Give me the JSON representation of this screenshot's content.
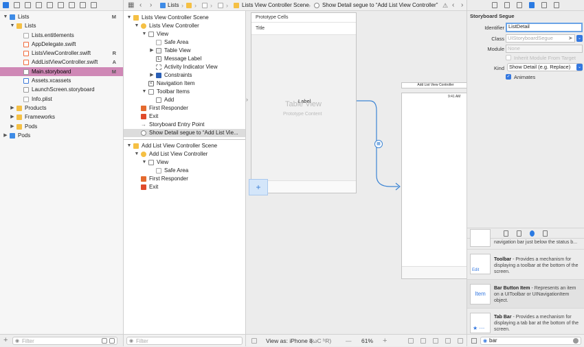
{
  "navigator": {
    "tree": [
      {
        "label": "Lists",
        "badge": "M",
        "level": 0,
        "disclosure": "open",
        "icon": "project-icon",
        "selected": false
      },
      {
        "label": "Lists",
        "badge": "",
        "level": 1,
        "disclosure": "open",
        "icon": "folder-icon",
        "selected": false
      },
      {
        "label": "Lists.entitlements",
        "badge": "",
        "level": 2,
        "disclosure": "",
        "icon": "file-icon",
        "selected": false
      },
      {
        "label": "AppDelegate.swift",
        "badge": "",
        "level": 2,
        "disclosure": "",
        "icon": "swift-icon",
        "selected": false
      },
      {
        "label": "ListsViewController.swift",
        "badge": "R",
        "level": 2,
        "disclosure": "",
        "icon": "swift-icon",
        "selected": false
      },
      {
        "label": "AddListViewController.swift",
        "badge": "A",
        "level": 2,
        "disclosure": "",
        "icon": "swift-icon",
        "selected": false
      },
      {
        "label": "Main.storyboard",
        "badge": "M",
        "level": 2,
        "disclosure": "",
        "icon": "storyboard-icon",
        "selected": true
      },
      {
        "label": "Assets.xcassets",
        "badge": "",
        "level": 2,
        "disclosure": "",
        "icon": "assets-icon",
        "selected": false
      },
      {
        "label": "LaunchScreen.storyboard",
        "badge": "",
        "level": 2,
        "disclosure": "",
        "icon": "storyboard-icon",
        "selected": false
      },
      {
        "label": "Info.plist",
        "badge": "",
        "level": 2,
        "disclosure": "",
        "icon": "plist-icon",
        "selected": false
      },
      {
        "label": "Products",
        "badge": "",
        "level": 1,
        "disclosure": "closed",
        "icon": "folder-icon",
        "selected": false
      },
      {
        "label": "Frameworks",
        "badge": "",
        "level": 1,
        "disclosure": "closed",
        "icon": "folder-icon",
        "selected": false
      },
      {
        "label": "Pods",
        "badge": "",
        "level": 1,
        "disclosure": "closed",
        "icon": "folder-icon",
        "selected": false
      },
      {
        "label": "Pods",
        "badge": "",
        "level": 0,
        "disclosure": "closed",
        "icon": "project-icon",
        "selected": false
      }
    ],
    "filter_placeholder": "Filter"
  },
  "jump_bar": {
    "crumbs": [
      "Lists",
      "",
      "",
      "",
      "Lists View Controller Scene",
      "Show Detail segue to “Add List View Controller”"
    ]
  },
  "outline": {
    "rows": [
      {
        "label": "Lists View Controller Scene",
        "level": 0,
        "disclosure": "open",
        "icon": "scene-icon",
        "selected": false
      },
      {
        "label": "Lists View Controller",
        "level": 1,
        "disclosure": "open",
        "icon": "view-controller-icon",
        "selected": false
      },
      {
        "label": "View",
        "level": 2,
        "disclosure": "open",
        "icon": "view-icon",
        "selected": false
      },
      {
        "label": "Safe Area",
        "level": 3,
        "disclosure": "",
        "icon": "safe-area-icon",
        "selected": false
      },
      {
        "label": "Table View",
        "level": 3,
        "disclosure": "closed",
        "icon": "table-view-icon",
        "selected": false
      },
      {
        "label": "Message Label",
        "level": 3,
        "disclosure": "",
        "icon": "label-icon",
        "selected": false
      },
      {
        "label": "Activity Indicator View",
        "level": 3,
        "disclosure": "",
        "icon": "activity-indicator-icon",
        "selected": false
      },
      {
        "label": "Constraints",
        "level": 3,
        "disclosure": "closed",
        "icon": "constraints-icon",
        "selected": false
      },
      {
        "label": "Navigation Item",
        "level": 2,
        "disclosure": "",
        "icon": "navigation-item-icon",
        "selected": false
      },
      {
        "label": "Toolbar Items",
        "level": 2,
        "disclosure": "open",
        "icon": "toolbar-icon",
        "selected": false
      },
      {
        "label": "Add",
        "level": 3,
        "disclosure": "",
        "icon": "bar-button-item-icon",
        "selected": false
      },
      {
        "label": "First Responder",
        "level": 1,
        "disclosure": "",
        "icon": "first-responder-icon",
        "selected": false
      },
      {
        "label": "Exit",
        "level": 1,
        "disclosure": "",
        "icon": "exit-icon",
        "selected": false
      },
      {
        "label": "Storyboard Entry Point",
        "level": 1,
        "disclosure": "",
        "icon": "entry-point-icon",
        "selected": false
      },
      {
        "label": "Show Detail segue to “Add List Vie...",
        "level": 1,
        "disclosure": "",
        "icon": "segue-icon",
        "selected": true
      }
    ],
    "rows2": [
      {
        "label": "Add List View Controller Scene",
        "level": 0,
        "disclosure": "open",
        "icon": "scene-icon",
        "selected": false
      },
      {
        "label": "Add List View Controller",
        "level": 1,
        "disclosure": "open",
        "icon": "view-controller-icon",
        "selected": false
      },
      {
        "label": "View",
        "level": 2,
        "disclosure": "open",
        "icon": "view-icon",
        "selected": false
      },
      {
        "label": "Safe Area",
        "level": 3,
        "disclosure": "",
        "icon": "safe-area-icon",
        "selected": false
      },
      {
        "label": "First Responder",
        "level": 1,
        "disclosure": "",
        "icon": "first-responder-icon",
        "selected": false
      },
      {
        "label": "Exit",
        "level": 1,
        "disclosure": "",
        "icon": "exit-icon",
        "selected": false
      }
    ],
    "filter_placeholder": "Filter"
  },
  "canvas": {
    "prototype_cells": "Prototype Cells",
    "cell_title": "Title",
    "label_text": "Label",
    "table_view_text": "Table View",
    "prototype_content": "Prototype Content",
    "add_symbol": "+",
    "add_list_header": "Add List View Controller",
    "status_time": "9:41 AM"
  },
  "canvas_bar": {
    "view_as": "View as: iPhone 8",
    "shortcut": "(ωC ʰR)",
    "zoom_out": "—",
    "zoom": "61%",
    "zoom_in": "+"
  },
  "inspector": {
    "section_title": "Storyboard Segue",
    "identifier_label": "Identifier",
    "identifier_value": "ListDetail",
    "class_label": "Class",
    "class_placeholder": "UIStoryboardSegue",
    "module_label": "Module",
    "module_value": "None",
    "inherit_label": "Inherit Module From Target",
    "kind_label": "Kind",
    "kind_value": "Show Detail (e.g. Replace)",
    "animates_label": "Animates",
    "library": [
      {
        "title": "",
        "desc": "navigation bar just below the status b...",
        "thumb": ""
      },
      {
        "title": "Toolbar",
        "desc": " - Provides a mechanism for displaying a toolbar at the bottom of the screen.",
        "thumb": "Edit"
      },
      {
        "title": "Bar Button Item",
        "desc": " - Represents an item on a UIToolbar or UINavigationItem object.",
        "thumb": "Item"
      },
      {
        "title": "Tab Bar",
        "desc": " - Provides a mechanism for displaying a tab bar at the bottom of the screen.",
        "thumb": "★ ⋯"
      }
    ],
    "search_value": "bar"
  },
  "colors": {
    "selection_navigator": "#cf88b6",
    "accent": "#3478e0",
    "segue_line": "#3d85d4"
  }
}
